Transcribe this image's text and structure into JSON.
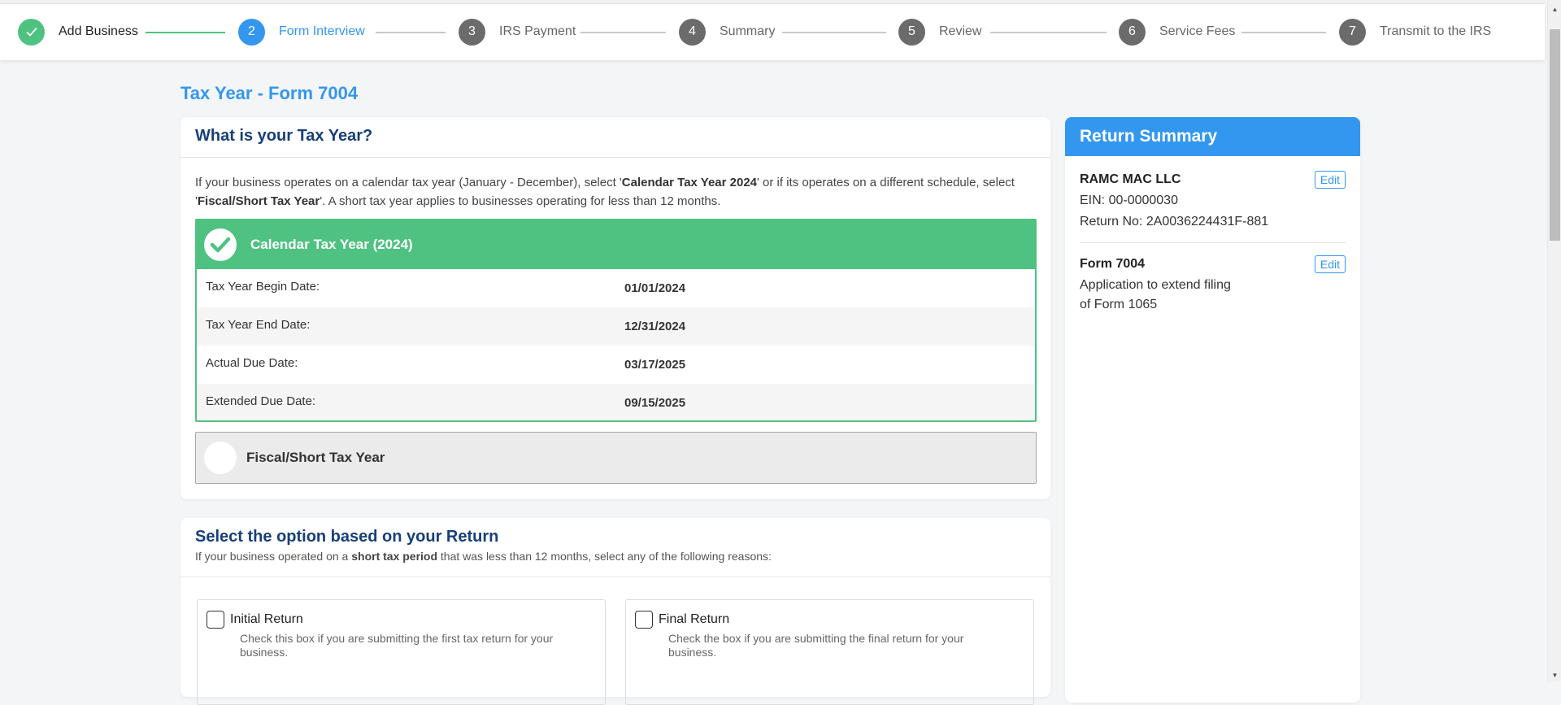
{
  "stepper": {
    "steps": [
      {
        "number": "✓",
        "label": "Add Business",
        "state": "done"
      },
      {
        "number": "2",
        "label": "Form Interview",
        "state": "active"
      },
      {
        "number": "3",
        "label": "IRS Payment",
        "state": "pending"
      },
      {
        "number": "4",
        "label": "Summary",
        "state": "pending"
      },
      {
        "number": "5",
        "label": "Review",
        "state": "pending"
      },
      {
        "number": "6",
        "label": "Service Fees",
        "state": "pending"
      },
      {
        "number": "7",
        "label": "Transmit to the IRS",
        "state": "pending"
      }
    ]
  },
  "page": {
    "title": "Tax Year - Form 7004"
  },
  "tax_year_card": {
    "heading": "What is your Tax Year?",
    "desc_part1": "If your business operates on a calendar tax year (January - December), select '",
    "desc_bold1": "Calendar Tax Year 2024",
    "desc_part2": "' or if its operates on a different schedule, select '",
    "desc_bold2": "Fiscal/Short Tax Year",
    "desc_part3": "'. A short tax year applies to businesses operating for less than 12 months.",
    "selected_option": {
      "title": "Calendar Tax Year (2024)",
      "rows": [
        {
          "label": "Tax Year Begin Date:",
          "value": "01/01/2024"
        },
        {
          "label": "Tax Year End Date:",
          "value": "12/31/2024"
        },
        {
          "label": "Actual Due Date:",
          "value": "03/17/2025"
        },
        {
          "label": "Extended Due Date:",
          "value": "09/15/2025"
        }
      ]
    },
    "other_option": {
      "title": "Fiscal/Short Tax Year"
    }
  },
  "return_card": {
    "heading": "Select the option based on your Return",
    "sub_part1": "If your business operated on a ",
    "sub_bold": "short tax period",
    "sub_part2": " that was less than 12 months, select any of the following reasons:",
    "choices": [
      {
        "label": "Initial Return",
        "help": "Check this box if you are submitting the first tax return for your business.",
        "checked": false
      },
      {
        "label": "Final Return",
        "help": "Check the box if you are submitting the final return for your business.",
        "checked": false
      }
    ]
  },
  "summary": {
    "heading": "Return Summary",
    "business": {
      "name": "RAMC MAC LLC",
      "ein": "EIN: 00-0000030",
      "return_no": "Return No: 2A0036224431F-881",
      "edit_label": "Edit"
    },
    "form": {
      "name": "Form 7004",
      "desc_line1": "Application to extend filing",
      "desc_line2": "of Form 1065",
      "edit_label": "Edit"
    }
  },
  "colors": {
    "primary_blue": "#3397ef",
    "success_green": "#4fc281",
    "heading_navy": "#173f7a",
    "pending_gray": "#6b6b6b"
  }
}
